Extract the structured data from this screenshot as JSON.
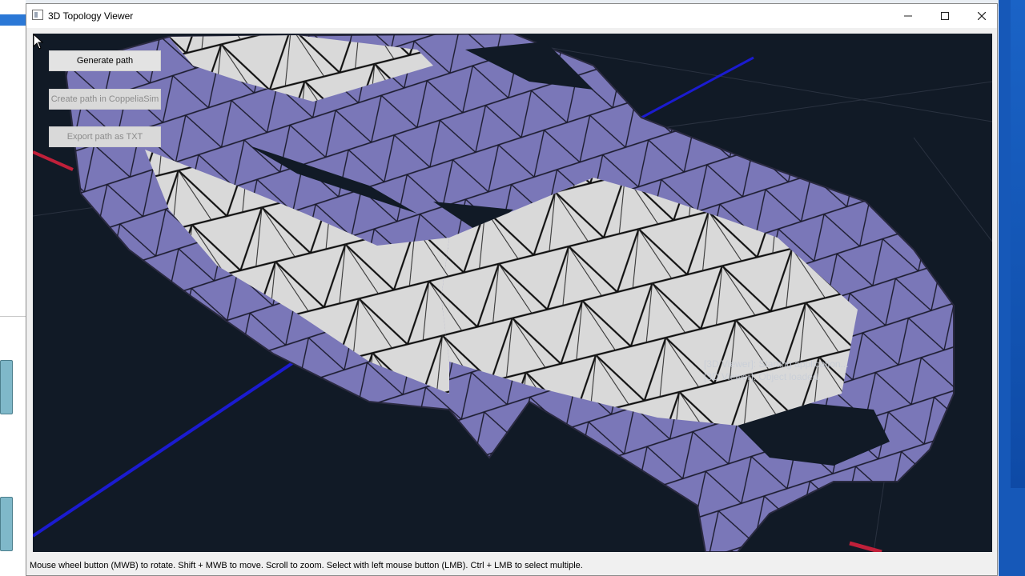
{
  "window": {
    "title": "3D Topology Viewer"
  },
  "buttons": {
    "generate_path": "Generate path",
    "create_path": "Create path in CoppeliaSim",
    "export_path": "Export path as TXT"
  },
  "log": {
    "line1": "[3D Viewer]: Starting application...",
    "line2": "[3D Viewer]: Object loaded."
  },
  "status": {
    "text": "Mouse wheel button (MWB) to rotate. Shift + MWB to move. Scroll to zoom. Select with left mouse button (LMB). Ctrl + LMB to select multiple."
  },
  "colors": {
    "viewport_bg": "#111a26",
    "mesh_fill": "#7a77b8",
    "mesh_selected": "#d9d9d9",
    "axis_blue": "#1b1bd0",
    "axis_red": "#c0203a"
  }
}
